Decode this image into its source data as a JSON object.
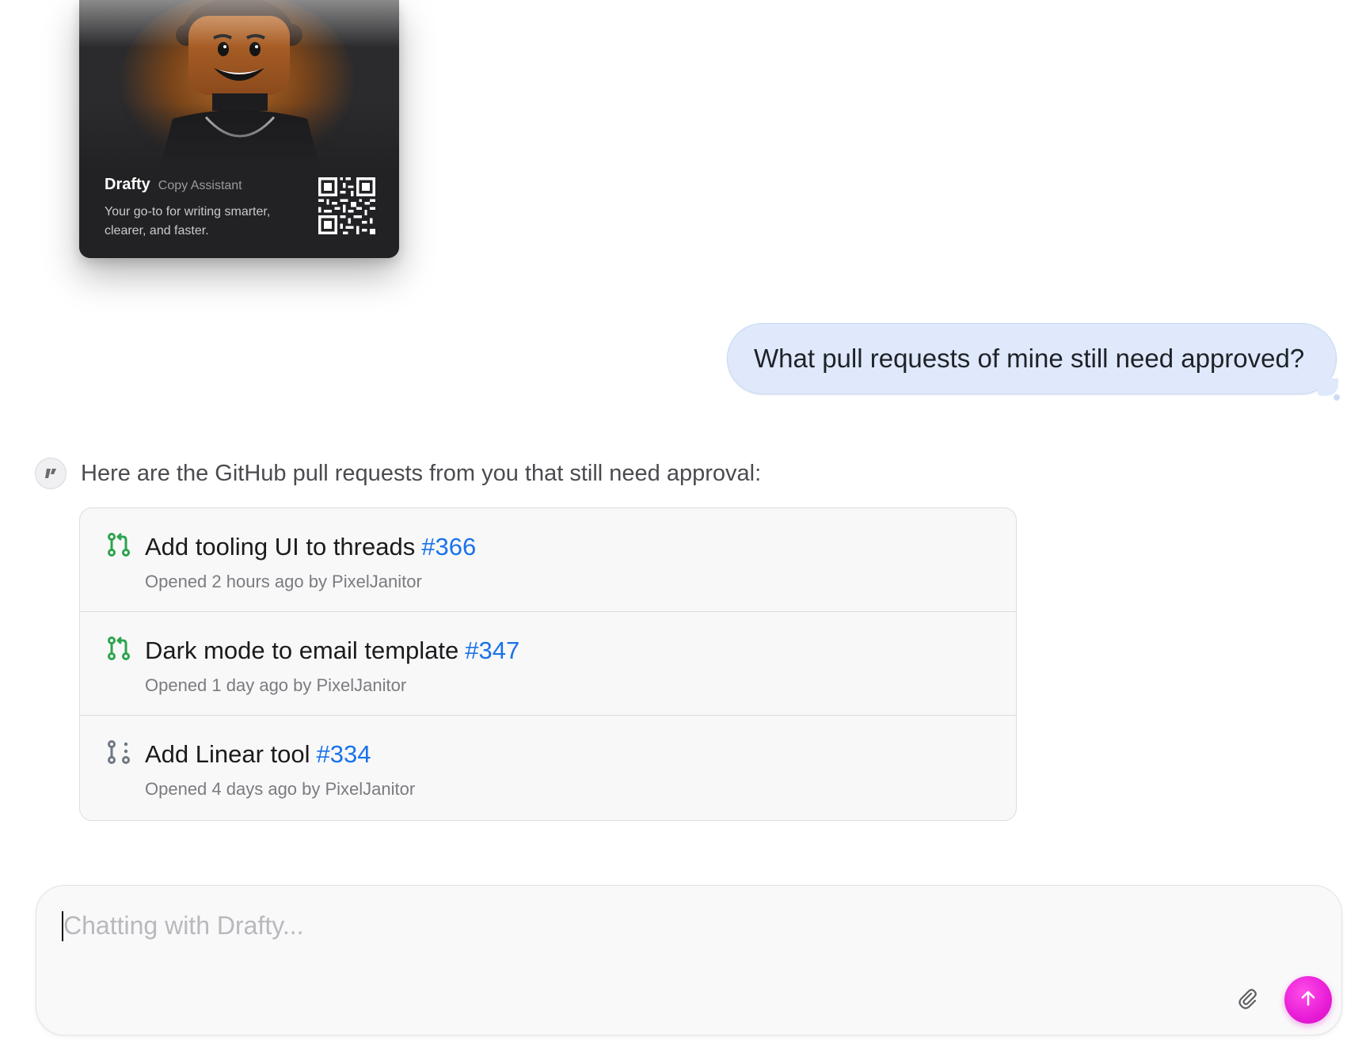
{
  "agent_card": {
    "name": "Drafty",
    "role": "Copy Assistant",
    "description": "Your go-to for writing smarter, clearer, and faster.",
    "avatar_icon": "lego-minifigure-avatar",
    "qr_icon": "qr-code-icon"
  },
  "user_message": {
    "text": "What pull requests of mine still need approved?"
  },
  "assistant_message": {
    "avatar_icon": "drafty-logo-icon",
    "intro": "Here are the GitHub pull requests from you that still need approval:",
    "pull_requests": [
      {
        "title": "Add tooling UI to threads",
        "number": "#366",
        "meta": "Opened 2 hours ago by PixelJanitor",
        "status": "open",
        "icon": "git-pull-request-icon"
      },
      {
        "title": "Dark mode to email template",
        "number": "#347",
        "meta": "Opened 1 day ago by PixelJanitor",
        "status": "open",
        "icon": "git-pull-request-icon"
      },
      {
        "title": "Add Linear tool",
        "number": "#334",
        "meta": "Opened 4 days ago by PixelJanitor",
        "status": "draft",
        "icon": "git-pull-request-draft-icon"
      }
    ]
  },
  "composer": {
    "placeholder": "Chatting with Drafty...",
    "value": "",
    "attach_icon": "paperclip-icon",
    "send_icon": "arrow-up-icon"
  },
  "colors": {
    "user_bubble": "#dfe9fb",
    "pr_open": "#2da44e",
    "pr_draft": "#6e7781",
    "link": "#1a73e8",
    "send_button": "#e81cd6",
    "card_bg": "#222224"
  }
}
